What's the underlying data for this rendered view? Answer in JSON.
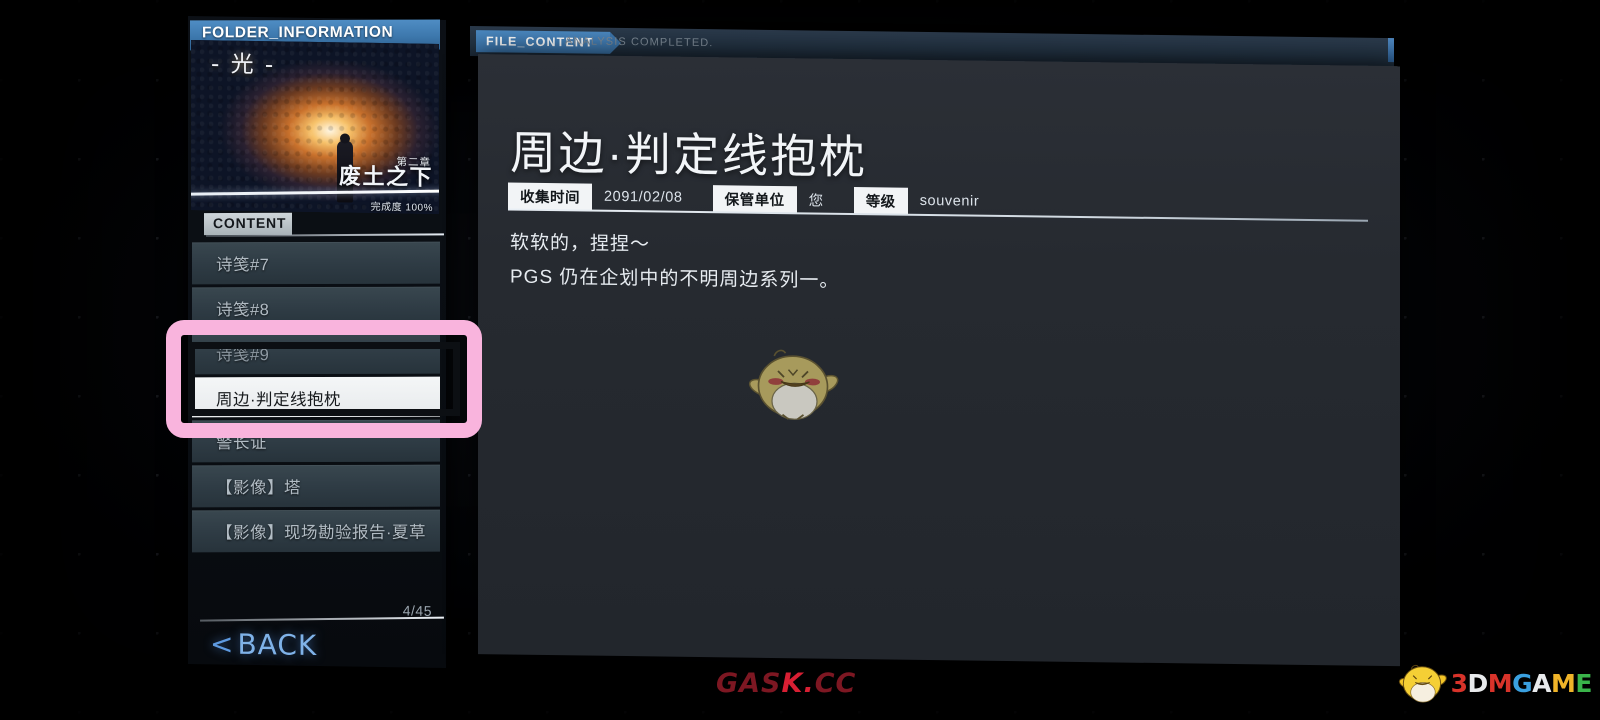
{
  "sidebar": {
    "folder_tab_label": "FOLDER_INFORMATION",
    "hero": {
      "title": "- 光 -",
      "chapter_number": "第二章",
      "chapter_name": "废土之下",
      "progress": "完成度 100%"
    },
    "content_tab_label": "CONTENT",
    "items": [
      {
        "label": "诗笺#7",
        "state": "normal"
      },
      {
        "label": "诗笺#8",
        "state": "normal"
      },
      {
        "label": "诗笺#9",
        "state": "dim"
      },
      {
        "label": "周边·判定线抱枕",
        "state": "selected"
      },
      {
        "label": "警长证",
        "state": "normal"
      },
      {
        "label": "【影像】塔",
        "state": "normal"
      },
      {
        "label": "【影像】现场勘验报告·夏草",
        "state": "normal"
      }
    ],
    "counter": "4/45",
    "back_chevron": "<",
    "back_label": "BACK"
  },
  "main": {
    "file_chip_label": "FILE_CONTENT",
    "status": "ANALYSIS COMPLETED.",
    "title": "周边·判定线抱枕",
    "meta": [
      {
        "key": "收集时间",
        "value": "2091/02/08"
      },
      {
        "key": "保管单位",
        "value": "您"
      },
      {
        "key": "等级",
        "value": "souvenir"
      }
    ],
    "body_lines": [
      "软软的，捏捏～",
      "PGS 仍在企划中的不明周边系列一。"
    ]
  },
  "watermarks": {
    "gask_part1": "GAS",
    "gask_part2": "K.",
    "gask_part3": "CC",
    "logo_3dm": [
      "3",
      "D",
      "M",
      "G",
      "A",
      "M",
      "E"
    ]
  },
  "colors": {
    "accent_blue": "#4b88c0",
    "highlight_pink": "#f9b4dd",
    "selected_bg": "#f4f6f7",
    "panel_bg": "#262a30",
    "list_row_bg": "#2f3c45"
  }
}
